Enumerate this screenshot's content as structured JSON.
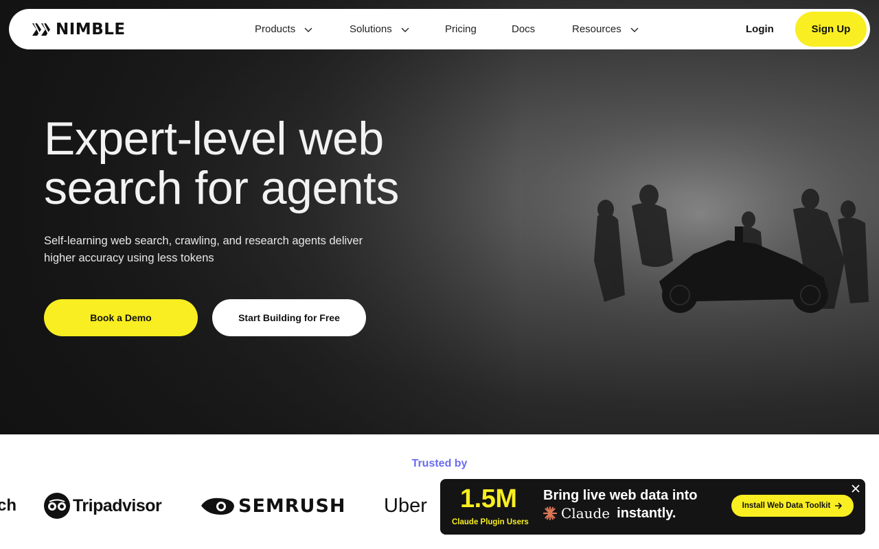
{
  "brand": {
    "name": "NIMBLE"
  },
  "nav": {
    "items": [
      {
        "label": "Products",
        "has_dropdown": true
      },
      {
        "label": "Solutions",
        "has_dropdown": true
      },
      {
        "label": "Pricing",
        "has_dropdown": false
      },
      {
        "label": "Docs",
        "has_dropdown": false
      },
      {
        "label": "Resources",
        "has_dropdown": true
      }
    ],
    "login_label": "Login",
    "signup_label": "Sign Up"
  },
  "hero": {
    "headline_line1": "Expert-level web",
    "headline_line2": "search for agents",
    "subhead_line1": "Self-learning web search, crawling, and research agents deliver",
    "subhead_line2": "higher accuracy using less tokens",
    "primary_cta": "Book a Demo",
    "secondary_cta": "Start Building for Free",
    "background_image": "race-car-pit-crew-in-fog"
  },
  "trusted": {
    "label": "Trusted by",
    "logos": [
      {
        "name": "partial-logo",
        "text": "ch"
      },
      {
        "name": "tripadvisor",
        "text": "Tripadvisor"
      },
      {
        "name": "semrush",
        "text": "SEMRUSH"
      },
      {
        "name": "uber",
        "text": "Uber"
      }
    ]
  },
  "promo": {
    "stat": "1.5M",
    "stat_label": "Claude Plugin Users",
    "title_line1": "Bring live web data into",
    "claude_word": "Claude",
    "title_line2_suffix": "instantly.",
    "cta": "Install Web Data Toolkit"
  },
  "colors": {
    "accent_yellow": "#f8ee21",
    "trusted_label": "#6a6cf0",
    "promo_bg": "#141414",
    "claude_orange": "#d97757"
  }
}
